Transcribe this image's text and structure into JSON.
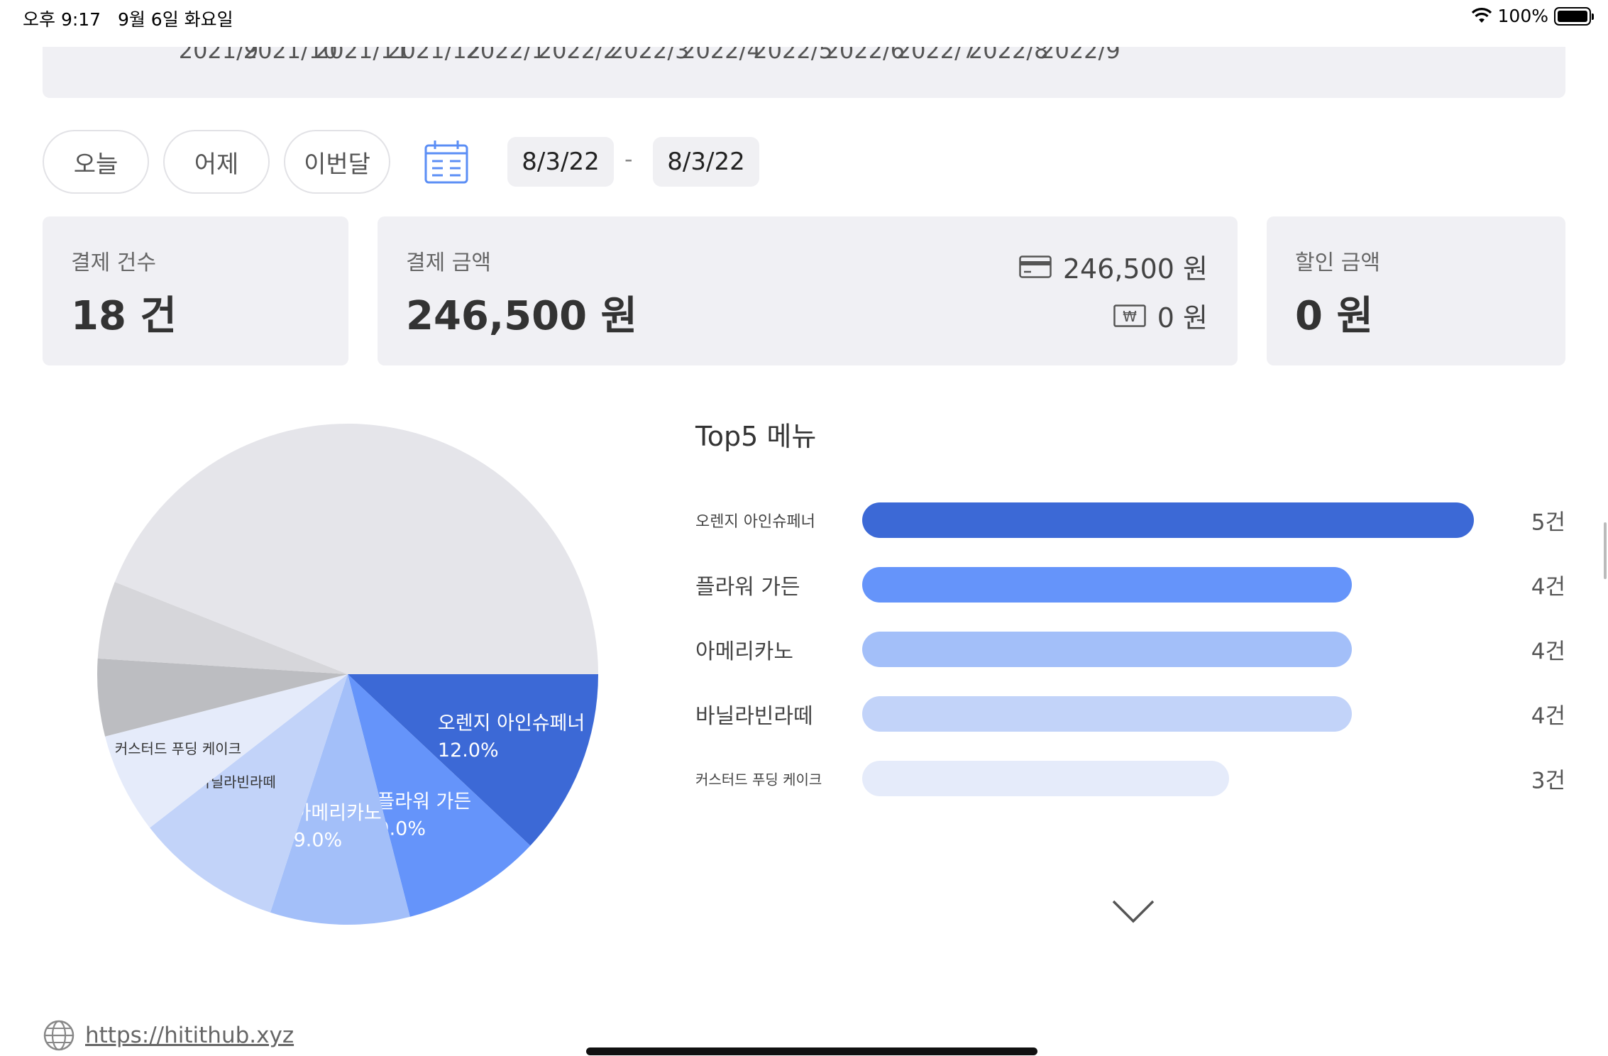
{
  "status_bar": {
    "time": "오후 9:17",
    "date": "9월 6일 화요일",
    "battery_percent": "100%",
    "battery_level": 1.0
  },
  "top_chart": {
    "tick_labels": [
      "2021/9",
      "2021/10",
      "2021/11",
      "2021/12",
      "2022/1",
      "2022/2",
      "2022/3",
      "2022/4",
      "2022/5",
      "2022/6",
      "2022/7",
      "2022/8",
      "2022/9"
    ]
  },
  "filters": {
    "today": "오늘",
    "yesterday": "어제",
    "this_month": "이번달",
    "start_date": "8/3/22",
    "separator": "-",
    "end_date": "8/3/22"
  },
  "summary": {
    "count": {
      "label": "결제 건수",
      "value": "18 건"
    },
    "amount": {
      "label": "결제 금액",
      "value": "246,500 원",
      "card_amount": "246,500 원",
      "cash_amount": "0 원"
    },
    "discount": {
      "label": "할인 금액",
      "value": "0 원"
    }
  },
  "pie": {
    "slices": [
      {
        "name": "오렌지 아인슈페너",
        "percent": 12.0,
        "percent_label": "12.0%",
        "color": "#3c69d6",
        "label_color": "#ffffff"
      },
      {
        "name": "플라워 가든",
        "percent": 9.0,
        "percent_label": "9.0%",
        "color": "#6594fa",
        "label_color": "#ffffff"
      },
      {
        "name": "아메리카노",
        "percent": 9.0,
        "percent_label": "9.0%",
        "color": "#a3bff9",
        "label_color": "#ffffff"
      },
      {
        "name": "바닐라빈라떼",
        "percent": 9.5,
        "percent_label": "",
        "color": "#c2d3f9",
        "label_color": "#333333"
      },
      {
        "name": "커스터드 푸딩 케이크",
        "percent": 6.5,
        "percent_label": "",
        "color": "#e5ebfa",
        "label_color": "#333333"
      },
      {
        "name": "",
        "percent": 5.0,
        "percent_label": "",
        "color": "#bcbdc1",
        "label_color": "#333333"
      },
      {
        "name": "",
        "percent": 5.0,
        "percent_label": "",
        "color": "#d6d6da",
        "label_color": "#333333"
      },
      {
        "name": "",
        "percent": 44.0,
        "percent_label": "",
        "color": "#e5e5ea",
        "label_color": "#333333"
      }
    ]
  },
  "top5": {
    "title": "Top5 메뉴",
    "items": [
      {
        "name": "오렌지 아인슈페너",
        "count": 5,
        "count_label": "5건",
        "color": "#3c69d6"
      },
      {
        "name": "플라워 가든",
        "count": 4,
        "count_label": "4건",
        "color": "#6594fa"
      },
      {
        "name": "아메리카노",
        "count": 4,
        "count_label": "4건",
        "color": "#a3bff9"
      },
      {
        "name": "바닐라빈라떼",
        "count": 4,
        "count_label": "4건",
        "color": "#c2d3f9"
      },
      {
        "name": "커스터드 푸딩 케이크",
        "count": 3,
        "count_label": "3건",
        "color": "#e5ebfa"
      }
    ]
  },
  "footer": {
    "url": "https://hitithub.xyz"
  }
}
